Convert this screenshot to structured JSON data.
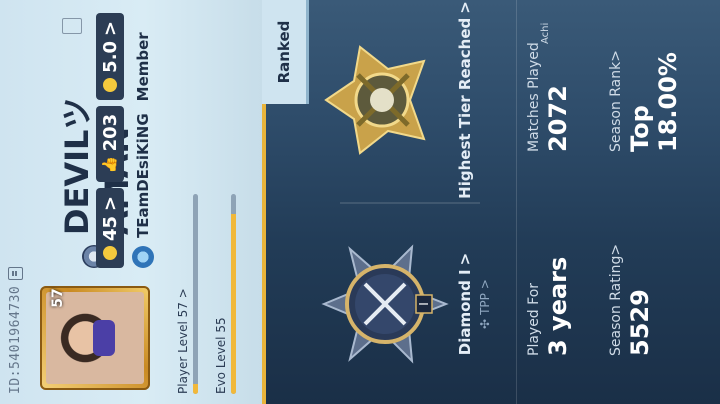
{
  "profile": {
    "id_text": "ID:5401964730",
    "player_name": "DEVILツAMAN",
    "avatar_level": "57",
    "stats": [
      {
        "value": "45",
        "suffix": ">"
      },
      {
        "value": "203"
      },
      {
        "value": "5.0",
        "suffix": ">"
      }
    ],
    "clan_name": "TEamDEsiKiNG",
    "clan_role": "Member",
    "player_level_label": "Player Level 57",
    "player_level_arrow": ">",
    "player_level_progress": 0.05,
    "evo_level_label": "Evo Level 55",
    "evo_level_progress": 0.9
  },
  "ranked": {
    "tab_label": "Ranked",
    "current_tier": "Diamond I",
    "current_tier_arrow": ">",
    "mode": "TPP",
    "mode_arrow": ">",
    "tier_numeral": "I",
    "highest_tier_label": "Highest Tier Reached",
    "highest_tier_arrow": ">"
  },
  "stats": {
    "played_for_label": "Played For",
    "played_for_value": "3 years",
    "matches_label": "Matches Played",
    "matches_value": "2072",
    "rating_label": "Season Rating>",
    "rating_value": "5529",
    "season_rank_label": "Season Rank>",
    "season_rank_value": "Top 18.00%",
    "achieve_label": "Achi"
  },
  "colors": {
    "accent_gold": "#e9b43a",
    "panel_light": "#cfe4f0",
    "dark_text": "#1f3048",
    "bg_dark": "#1a2f47"
  }
}
